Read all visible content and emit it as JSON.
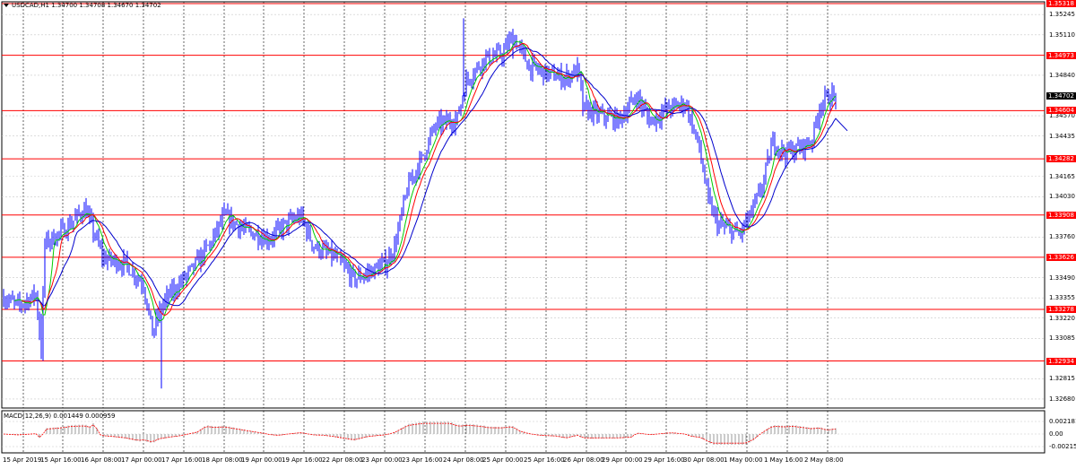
{
  "window": {
    "symbol_info": "USDCAD,H1  1.34700 1.34708 1.34670 1.34702"
  },
  "macd": {
    "label": "MACD(12,26,9) 0.001449 0.000959",
    "axis_labels": [
      "0.002181",
      "0.00",
      "-0.002154"
    ]
  },
  "price_axis": {
    "labels": [
      "1.35245",
      "1.35110",
      "1.34840",
      "1.34570",
      "1.34435",
      "1.34165",
      "1.34030",
      "1.33760",
      "1.33490",
      "1.33355",
      "1.33220",
      "1.33085",
      "1.32815",
      "1.32680"
    ],
    "levels": [
      "1.35318",
      "1.34973",
      "1.34604",
      "1.34282",
      "1.33908",
      "1.33626",
      "1.33278",
      "1.32934"
    ],
    "current": "1.34702"
  },
  "time_axis": [
    "15 Apr 2019",
    "15 Apr 16:00",
    "16 Apr 08:00",
    "17 Apr 00:00",
    "17 Apr 16:00",
    "18 Apr 08:00",
    "19 Apr 00:00",
    "19 Apr 16:00",
    "22 Apr 08:00",
    "23 Apr 00:00",
    "23 Apr 16:00",
    "24 Apr 08:00",
    "25 Apr 00:00",
    "25 Apr 16:00",
    "26 Apr 08:00",
    "29 Apr 00:00",
    "29 Apr 16:00",
    "30 Apr 08:00",
    "1 May 00:00",
    "1 May 16:00",
    "2 May 08:00"
  ],
  "colors": {
    "candles": "#0000ff",
    "ma_fast": "#00cc00",
    "ma_mid": "#ff0000",
    "ma_slow": "#0000cc",
    "levels": "#ff0000",
    "grid": "#c0c0c0",
    "macd_signal": "#ff0000"
  }
}
